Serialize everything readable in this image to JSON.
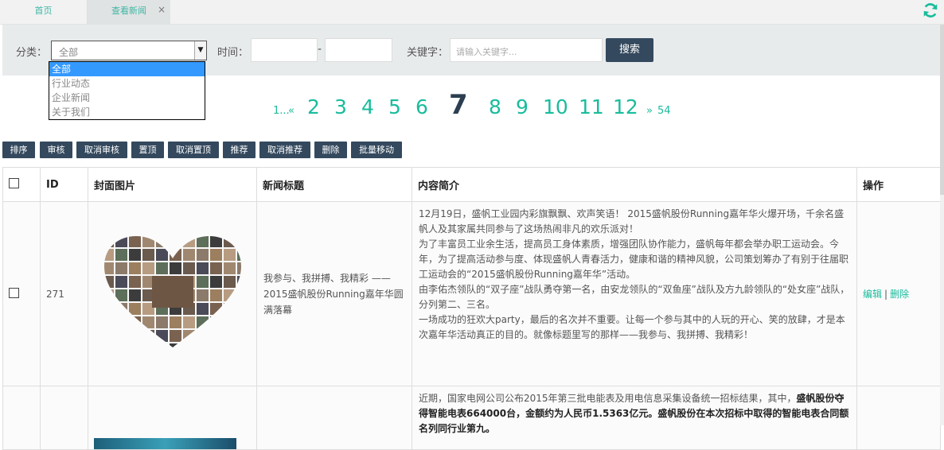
{
  "tabs": [
    {
      "label": "首页"
    },
    {
      "label": "查看新闻",
      "close": "×"
    }
  ],
  "filter": {
    "category_label": "分类：",
    "category_value": "全部",
    "category_options": [
      "全部",
      "行业动态",
      "企业新闻",
      "关于我们"
    ],
    "time_label": "时间：",
    "date_from": "",
    "date_to": "",
    "date_separator": "-",
    "keyword_label": "关键字：",
    "keyword_placeholder": "请输入关键字...",
    "search_label": "搜索"
  },
  "pagination": {
    "first": "1...",
    "prev": "«",
    "pages": [
      "2",
      "3",
      "4",
      "5",
      "6"
    ],
    "current": "7",
    "pages_after": [
      "8",
      "9",
      "10",
      "11",
      "12"
    ],
    "next": "»",
    "last": "54"
  },
  "toolbar": {
    "buttons": [
      "排序",
      "审核",
      "取消审核",
      "置顶",
      "取消置顶",
      "推荐",
      "取消推荐",
      "删除",
      "批量移动"
    ]
  },
  "table": {
    "headers": [
      "",
      "ID",
      "封面图片",
      "新闻标题",
      "内容简介",
      "操作"
    ],
    "rows": [
      {
        "id": "271",
        "title": "我参与、我拼搏、我精彩 ——2015盛帆股份Running嘉年华圆满落幕",
        "summary": [
          "12月19日，盛帆工业园内彩旗飘飘、欢声笑语！ 2015盛帆股份Running嘉年华火爆开场，千余名盛帆人及其家属共同参与了这场热闹非凡的欢乐派对！",
          "为了丰富员工业余生活，提高员工身体素质，增强团队协作能力，盛帆每年都会举办职工运动会。今年，为了提高活动参与度、体现盛帆人青春活力，健康和谐的精神风貌，公司策划筹办了有别于往届职工运动会的“2015盛帆股份Running嘉年华”活动。",
          "由李佑杰领队的“双子座”战队勇夺第一名，由安龙领队的“双鱼座”战队及方九龄领队的“处女座”战队，分列第二、三名。",
          "一场成功的狂欢大party，最后的名次并不重要。让每一个参与其中的人玩的开心、笑的放肆，才是本次嘉年华活动真正的目的。就像标题里写的那样——我参与、我拼搏、我精彩！"
        ],
        "edit": "编辑",
        "sep": "|",
        "delete": "删除"
      },
      {
        "id": "",
        "title": "",
        "summary_plain": "近期，国家电网公司公布2015年第三批电能表及用电信息采集设备统一招标结果，其中，",
        "summary_bold": "盛帆股份夺得智能电表664000台，金额约为人民币1.5363亿元。盛帆股份在本次招标中取得的智能电表合同额名列同行业第九。"
      }
    ]
  },
  "colors": {
    "accent": "#1abc9c",
    "dark_button": "#34495e",
    "filter_bg": "#e8ebec",
    "selected_option": "#3399ff"
  }
}
